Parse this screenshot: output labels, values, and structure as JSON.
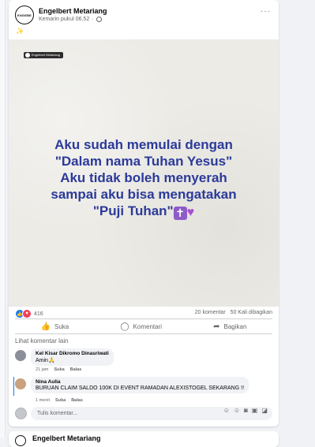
{
  "post": {
    "author": "Engelbert Metariang",
    "avatar_text": "ENGEBE",
    "timestamp": "Kemarin pukul 06.52",
    "caption": "✨",
    "image": {
      "watermark": "Engelbert Metariang",
      "quote_lines": [
        "Aku sudah memulai dengan",
        "\"Dalam nama Tuhan Yesus\"",
        "Aku tidak boleh menyerah",
        "sampai aku bisa mengatakan",
        "\"Puji Tuhan\""
      ]
    },
    "reaction_count": "416",
    "comment_count": "20 komentar",
    "share_count": "50 Kali dibagikan",
    "actions": {
      "like": "Suka",
      "comment": "Komentari",
      "share": "Bagikan"
    },
    "view_more_comments": "Lihat komentar lain",
    "comments": [
      {
        "author": "Kel Kisar Dikromo Dinasriwati",
        "text": "Amin🙏",
        "time": "21 jam",
        "like": "Suka",
        "reply": "Balas",
        "avatar_color": "#8a8f99"
      },
      {
        "author": "Nina Aulia",
        "text": "BURUAN CLAIM SALDO 100K DI EVENT RAMADAN ALEXISTOGEL SEKARANG !!",
        "time": "1 menit",
        "like": "Suka",
        "reply": "Balas",
        "avatar_color": "#c9a27e"
      }
    ],
    "comment_input_placeholder": "Tulis komentar..."
  },
  "next_post": {
    "author": "Engelbert Metariang"
  },
  "colors": {
    "quote_text": "#2b3a9a",
    "like_blue": "#1877f2",
    "love_red": "#f33e58"
  }
}
